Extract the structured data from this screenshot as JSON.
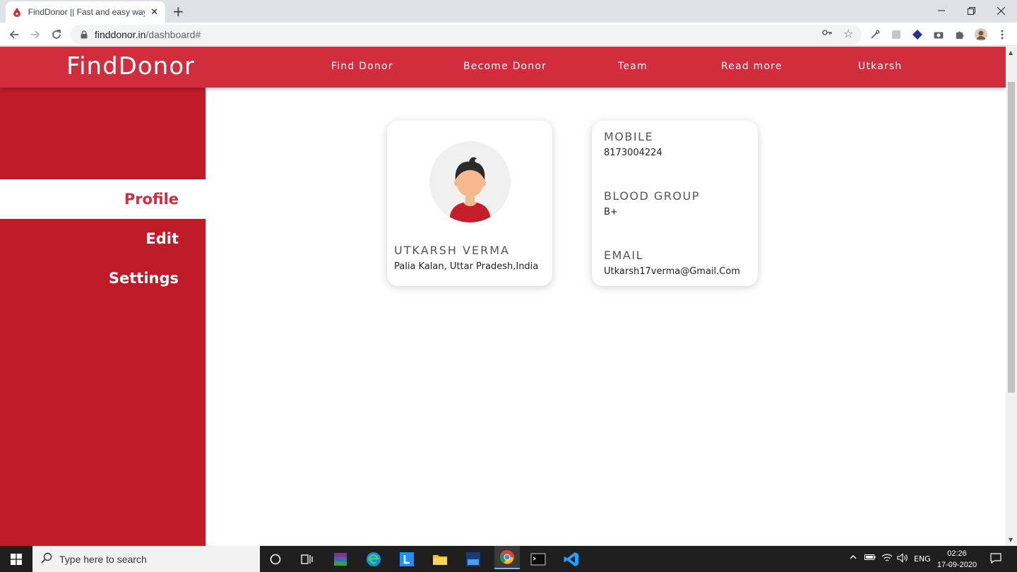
{
  "browser": {
    "tab_title": "FindDonor || Fast and easy way to find blood donors",
    "new_tab": "+",
    "url_domain": "finddonor.in",
    "url_path": "/dashboard#"
  },
  "site": {
    "brand": "FindDonor",
    "nav": [
      "Find Donor",
      "Become Donor",
      "Team",
      "Read more",
      "Utkarsh"
    ]
  },
  "sidebar": {
    "items": [
      {
        "label": "Profile",
        "active": true
      },
      {
        "label": "Edit",
        "active": false
      },
      {
        "label": "Settings",
        "active": false
      }
    ]
  },
  "profile": {
    "name": "UTKARSH VERMA",
    "location": "Palia Kalan, Uttar Pradesh,India"
  },
  "info": {
    "mobile_label": "MOBILE",
    "mobile_value": "8173004224",
    "blood_label": "BLOOD GROUP",
    "blood_value": "B+",
    "email_label": "EMAIL",
    "email_value": "Utkarsh17verma@Gmail.Com"
  },
  "taskbar": {
    "search_placeholder": "Type here to search",
    "language": "ENG",
    "time": "02:26",
    "date": "17-09-2020"
  },
  "colors": {
    "brand_red": "#d22d3d",
    "sidebar_red": "#c01b29"
  }
}
